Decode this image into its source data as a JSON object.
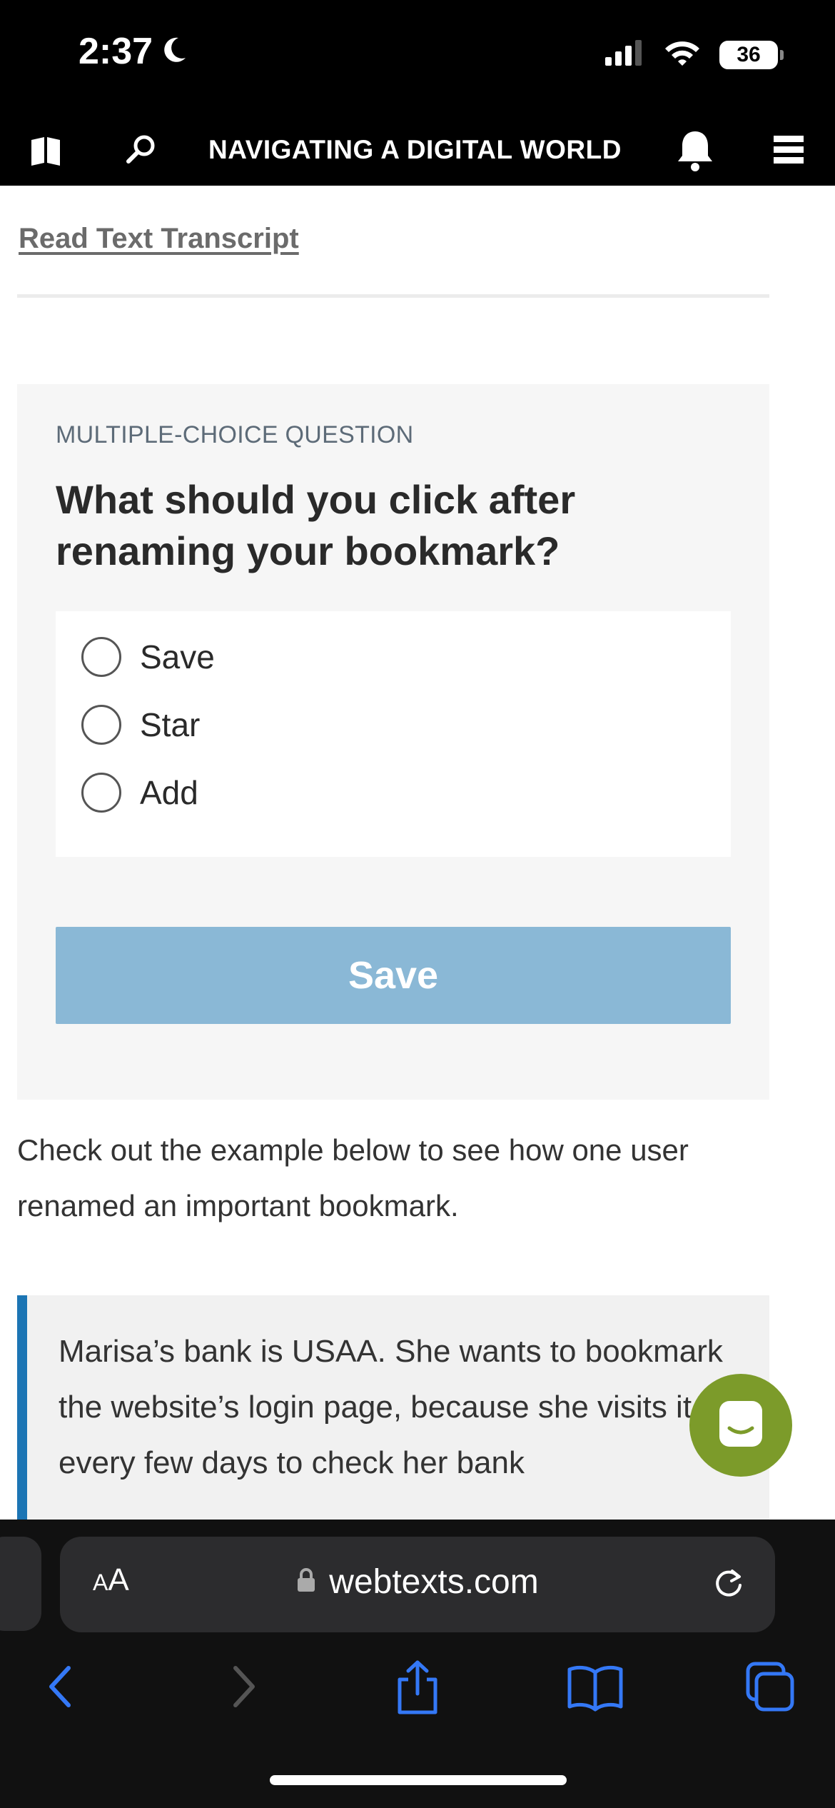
{
  "status_bar": {
    "time": "2:37",
    "battery": "36",
    "icons": [
      "moon-icon",
      "signal-icon",
      "wifi-icon",
      "battery-icon"
    ]
  },
  "header": {
    "title": "NAVIGATING A DIGITAL WORLD",
    "icons": [
      "book-icon",
      "search-icon",
      "bell-icon",
      "menu-icon"
    ]
  },
  "content": {
    "transcript_link": "Read Text Transcript",
    "quiz": {
      "kicker": "MULTIPLE-CHOICE QUESTION",
      "question": "What should you click after renaming your bookmark?",
      "options": [
        "Save",
        "Star",
        "Add"
      ],
      "submit_label": "Save"
    },
    "intro_text": "Check out the example below to see how one user renamed an important bookmark.",
    "example_text": "Marisa’s bank is USAA. She wants to bookmark the website’s login page, because she visits it every few days to check her bank"
  },
  "browser": {
    "text_size_label": "AA",
    "url": "webtexts.com",
    "toolbar_icons": [
      "back-icon",
      "forward-icon",
      "share-icon",
      "bookmarks-icon",
      "tabs-icon"
    ]
  },
  "colors": {
    "accent_blue": "#1c75b4",
    "save_button": "#8ab8d6",
    "chat_green": "#7c9b2a",
    "ios_blue": "#3478f6"
  }
}
